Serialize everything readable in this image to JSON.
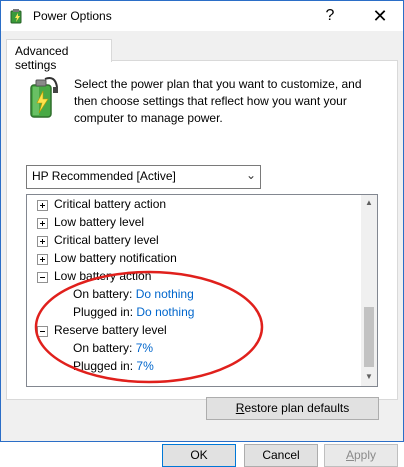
{
  "window": {
    "title": "Power Options",
    "help_glyph": "?",
    "close_glyph": "✕"
  },
  "tab": {
    "label": "Advanced settings"
  },
  "description": "Select the power plan that you want to customize, and then choose settings that reflect how you want your computer to manage power.",
  "plan_select": {
    "value": "HP Recommended [Active]"
  },
  "tree": {
    "items": [
      {
        "label": "Critical battery action",
        "state": "collapsed"
      },
      {
        "label": "Low battery level",
        "state": "collapsed"
      },
      {
        "label": "Critical battery level",
        "state": "collapsed"
      },
      {
        "label": "Low battery notification",
        "state": "collapsed"
      },
      {
        "label": "Low battery action",
        "state": "expanded",
        "on_battery_label": "On battery:",
        "on_battery_value": "Do nothing",
        "plugged_in_label": "Plugged in:",
        "plugged_in_value": "Do nothing"
      },
      {
        "label": "Reserve battery level",
        "state": "expanded",
        "on_battery_label": "On battery:",
        "on_battery_value": "7%",
        "plugged_in_label": "Plugged in:",
        "plugged_in_value": "7%"
      }
    ]
  },
  "buttons": {
    "restore": "Restore plan defaults",
    "restore_mnemonic": "R",
    "restore_rest": "estore plan defaults",
    "ok": "OK",
    "cancel": "Cancel",
    "apply": "Apply",
    "apply_mnemonic": "A",
    "apply_rest": "pply"
  },
  "colors": {
    "annotation": "#e0201c",
    "link": "#0066cc",
    "window_border": "#2b6ec7"
  }
}
